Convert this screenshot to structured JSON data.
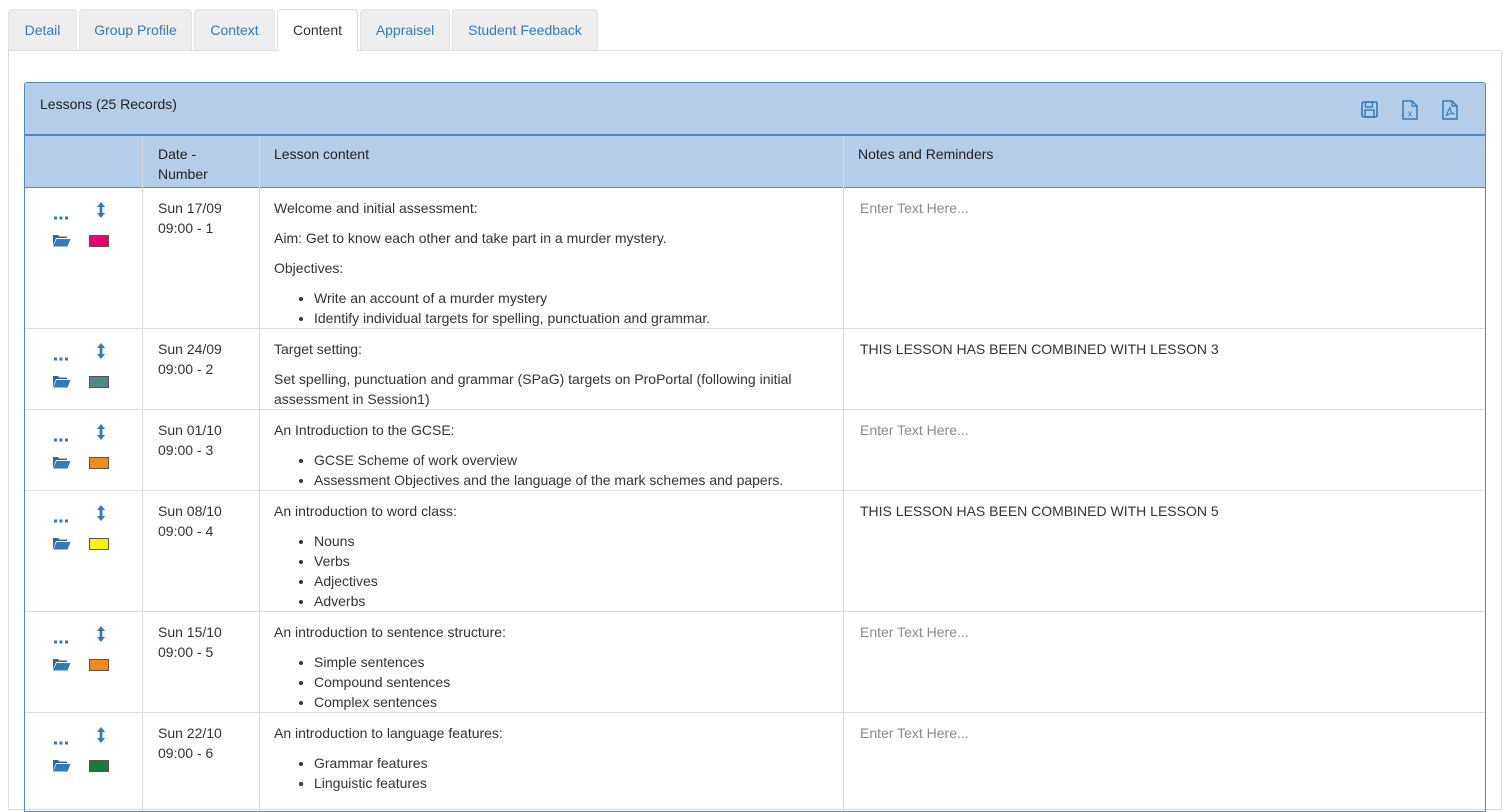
{
  "tabs": [
    {
      "label": "Detail"
    },
    {
      "label": "Group Profile"
    },
    {
      "label": "Context"
    },
    {
      "label": "Content",
      "active": true
    },
    {
      "label": "Appraisel"
    },
    {
      "label": "Student Feedback"
    }
  ],
  "panel": {
    "title": "Lessons (25 Records)",
    "tools": [
      "save-icon",
      "excel-export-icon",
      "pdf-export-icon"
    ]
  },
  "table": {
    "headers": {
      "date_line1": "Date -",
      "date_line2": "Number",
      "content": "Lesson content",
      "notes": "Notes and Reminders"
    },
    "rows": [
      {
        "date": "Sun 17/09",
        "time_number": "09:00 - 1",
        "color": "#e8006e",
        "paragraphs": [
          "Welcome and initial assessment:",
          "Aim: Get to know each other and take part in a murder mystery.",
          "Objectives:"
        ],
        "bullets": [
          "Write an account of a murder mystery",
          "Identify individual targets for spelling, punctuation and grammar."
        ],
        "notes": "Enter Text Here...",
        "notes_placeholder": true
      },
      {
        "date": "Sun 24/09",
        "time_number": "09:00 - 2",
        "color": "#4e8a8a",
        "paragraphs": [
          "Target setting:",
          "Set spelling, punctuation and grammar (SPaG) targets on ProPortal (following initial assessment in Session1)"
        ],
        "bullets": [],
        "notes": "THIS LESSON HAS BEEN COMBINED WITH LESSON 3",
        "notes_placeholder": false
      },
      {
        "date": "Sun 01/10",
        "time_number": "09:00 - 3",
        "color": "#f28a1a",
        "paragraphs": [
          "An Introduction to the GCSE:"
        ],
        "bullets": [
          "GCSE Scheme of work overview",
          "Assessment Objectives and the language of the mark schemes and papers."
        ],
        "notes": "Enter Text Here...",
        "notes_placeholder": true
      },
      {
        "date": "Sun 08/10",
        "time_number": "09:00 - 4",
        "color": "#f5f20c",
        "paragraphs": [
          "An introduction to word class:"
        ],
        "bullets": [
          "Nouns",
          "Verbs",
          "Adjectives",
          "Adverbs"
        ],
        "notes": "THIS LESSON HAS BEEN COMBINED WITH LESSON 5",
        "notes_placeholder": false
      },
      {
        "date": "Sun 15/10",
        "time_number": "09:00 - 5",
        "color": "#f28a1a",
        "paragraphs": [
          "An introduction to sentence structure:"
        ],
        "bullets": [
          "Simple sentences",
          "Compound sentences",
          "Complex sentences"
        ],
        "notes": "Enter Text Here...",
        "notes_placeholder": true
      },
      {
        "date": "Sun 22/10",
        "time_number": "09:00 - 6",
        "color": "#1a7a3e",
        "paragraphs": [
          "An introduction to language features:"
        ],
        "bullets": [
          "Grammar features",
          "Linguistic features"
        ],
        "notes": "Enter Text Here...",
        "notes_placeholder": true
      }
    ]
  },
  "icons": {
    "row_actions": [
      "more-options-icon",
      "reorder-arrows-icon",
      "folder-open-icon",
      "color-swatch"
    ]
  }
}
